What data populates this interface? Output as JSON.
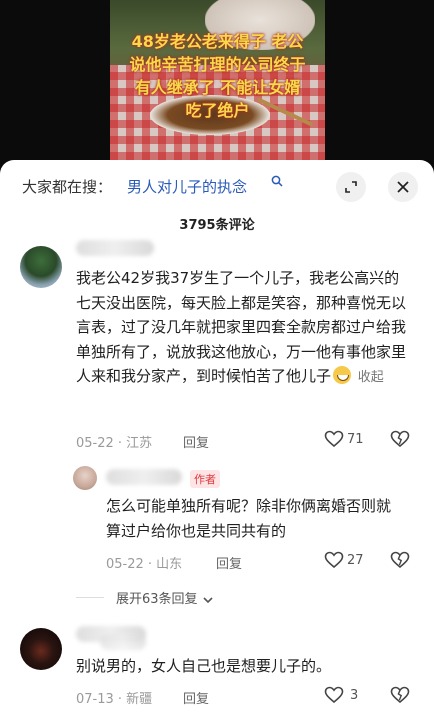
{
  "video": {
    "caption_lines": [
      "48岁老公老来得子 老公",
      "说他辛苦打理的公司终于",
      "有人继承了 不能让女婿",
      "吃了绝户"
    ]
  },
  "search": {
    "prefix": "大家都在搜：",
    "term": "男人对儿子的执念"
  },
  "comments_count": "3795条评论",
  "comments": [
    {
      "text": "我老公42岁我37岁生了一个儿子，我老公高兴的七天没出医院，每天脸上都是笑容，那种喜悦无以言表，过了没几年就把家里四套全款房都过户给我单独所有了，说放我这他放心，万一他有事他家里人来和我分家产，到时候怕苦了他儿子",
      "collapse": "收起",
      "date": "05-22 · 江苏",
      "reply": "回复",
      "likes": "71"
    },
    {
      "badge": "作者",
      "text": "怎么可能单独所有呢？除非你俩离婚否则就算过户给你也是共同共有的",
      "date": "05-22 · 山东",
      "reply": "回复",
      "likes": "27"
    },
    {
      "text": "别说男的，女人自己也是想要儿子的。",
      "date": "07-13 · 新疆",
      "reply": "回复",
      "likes": "3"
    }
  ],
  "expand_replies": "展开63条回复",
  "icons": [
    "search-icon",
    "expand-icon",
    "close-icon",
    "heart-icon",
    "broken-heart-icon",
    "chevron-down-icon",
    "grin-emoji-icon"
  ]
}
